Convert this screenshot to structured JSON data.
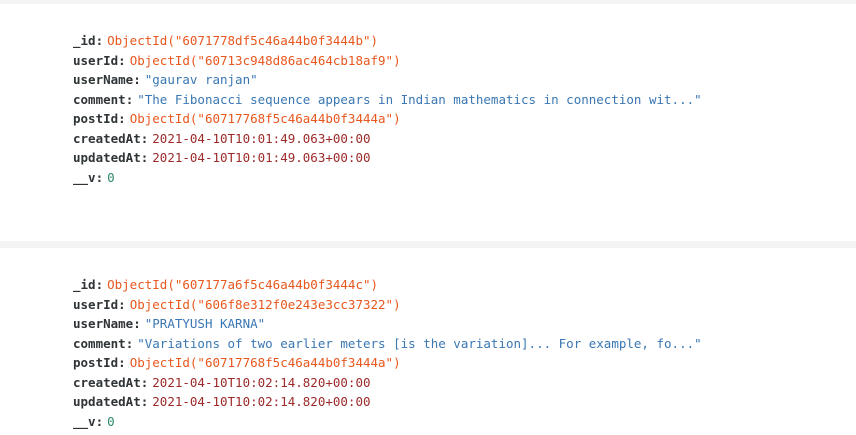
{
  "documents": [
    {
      "fields": [
        {
          "key": "_id",
          "value": "ObjectId(\"6071778df5c46a44b0f3444b\")",
          "type": "objectid"
        },
        {
          "key": "userId",
          "value": "ObjectId(\"60713c948d86ac464cb18af9\")",
          "type": "objectid"
        },
        {
          "key": "userName",
          "value": "\"gaurav ranjan\"",
          "type": "string"
        },
        {
          "key": "comment",
          "value": "\"The Fibonacci sequence appears in Indian mathematics in connection wit...\"",
          "type": "string"
        },
        {
          "key": "postId",
          "value": "ObjectId(\"60717768f5c46a44b0f3444a\")",
          "type": "objectid"
        },
        {
          "key": "createdAt",
          "value": "2021-04-10T10:01:49.063+00:00",
          "type": "date"
        },
        {
          "key": "updatedAt",
          "value": "2021-04-10T10:01:49.063+00:00",
          "type": "date"
        },
        {
          "key": "__v",
          "value": "0",
          "type": "number"
        }
      ]
    },
    {
      "fields": [
        {
          "key": "_id",
          "value": "ObjectId(\"607177a6f5c46a44b0f3444c\")",
          "type": "objectid"
        },
        {
          "key": "userId",
          "value": "ObjectId(\"606f8e312f0e243e3cc37322\")",
          "type": "objectid"
        },
        {
          "key": "userName",
          "value": "\"PRATYUSH KARNA\"",
          "type": "string"
        },
        {
          "key": "comment",
          "value": "\"Variations of two earlier meters [is the variation]... For example, fo...\"",
          "type": "string"
        },
        {
          "key": "postId",
          "value": "ObjectId(\"60717768f5c46a44b0f3444a\")",
          "type": "objectid"
        },
        {
          "key": "createdAt",
          "value": "2021-04-10T10:02:14.820+00:00",
          "type": "date"
        },
        {
          "key": "updatedAt",
          "value": "2021-04-10T10:02:14.820+00:00",
          "type": "date"
        },
        {
          "key": "__v",
          "value": "0",
          "type": "number"
        }
      ]
    }
  ],
  "colors": {
    "key": "#2f3437",
    "objectid": "#e8571e",
    "string": "#3a77b3",
    "date": "#9c2a2a",
    "number": "#2c8a6a",
    "card_background": "#ffffff",
    "page_background": "#f4f4f4"
  }
}
